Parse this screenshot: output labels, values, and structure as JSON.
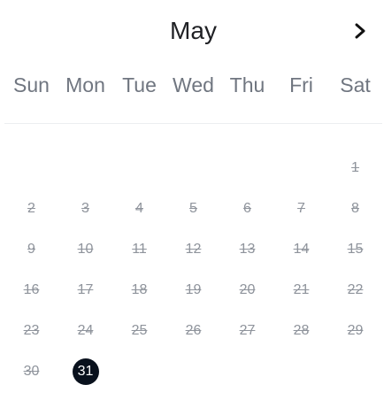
{
  "header": {
    "month": "May",
    "next_icon": "chevron-right-icon"
  },
  "weekdays": [
    "Sun",
    "Mon",
    "Tue",
    "Wed",
    "Thu",
    "Fri",
    "Sat"
  ],
  "days": [
    "",
    "",
    "",
    "",
    "",
    "",
    "1",
    "2",
    "3",
    "4",
    "5",
    "6",
    "7",
    "8",
    "9",
    "10",
    "11",
    "12",
    "13",
    "14",
    "15",
    "16",
    "17",
    "18",
    "19",
    "20",
    "21",
    "22",
    "23",
    "24",
    "25",
    "26",
    "27",
    "28",
    "29",
    "30",
    "31",
    "",
    "",
    "",
    "",
    ""
  ],
  "selected_day": "31",
  "colors": {
    "selected_bg": "#09111d",
    "disabled_text": "#8f949c"
  }
}
